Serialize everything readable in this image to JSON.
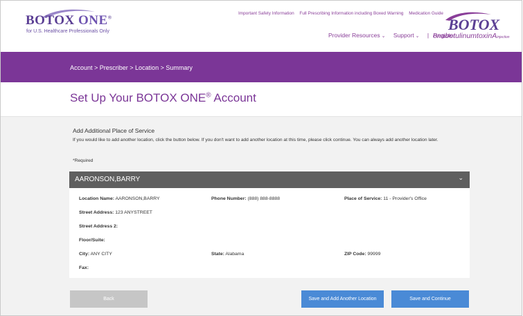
{
  "brand": {
    "left_logo": {
      "word": "BOTOX",
      "one": "ONE",
      "reg": "®",
      "tagline": "for U.S. Healthcare Professionals Only"
    },
    "right_logo": {
      "word": "BOTOX",
      "generic": "onabotulinumtoxinA",
      "generic_suffix": "injection"
    },
    "colors": {
      "purple": "#7b3697",
      "logo_purple": "#5b3f94",
      "button_blue": "#4a8ad6",
      "card_gray": "#5f5f5f"
    }
  },
  "header": {
    "top_links": [
      "Important Safety Information",
      "Full Prescribing Information including Boxed Warning",
      "Medication Guide"
    ],
    "nav": {
      "provider_resources": "Provider Resources",
      "support": "Support",
      "separator": "|",
      "register": "Register",
      "chevron_icon": "chevron-down-icon"
    }
  },
  "breadcrumb": "Account > Prescriber > Location > Summary",
  "page": {
    "title": "Set Up Your BOTOX ONE",
    "title_reg": "®",
    "title_suffix": " Account"
  },
  "intro": {
    "heading": "Add Additional Place of Service",
    "text": "If you would like to add another location, click the button below. If you don't want to add another location at this time, please click continue. You can always add another location later.",
    "required": "*Required"
  },
  "location_card": {
    "title": "AARONSON,BARRY",
    "chevron_icon": "chevron-down-icon",
    "location_name": {
      "label": "Location Name:",
      "value": "AARONSON,BARRY"
    },
    "phone": {
      "label": "Phone Number:",
      "value": "(888) 888-8888"
    },
    "place_of_service": {
      "label": "Place of Service:",
      "value": "11 - Provider's Office"
    },
    "street_1": {
      "label": "Street Address:",
      "value": "123 ANYSTREET"
    },
    "street_2": {
      "label": "Street Address 2:",
      "value": ""
    },
    "floor": {
      "label": "Floor/Suite:",
      "value": ""
    },
    "city": {
      "label": "City:",
      "value": "ANY CITY"
    },
    "state": {
      "label": "State:",
      "value": "Alabama"
    },
    "zip": {
      "label": "ZIP Code:",
      "value": "99999"
    },
    "fax": {
      "label": "Fax:",
      "value": ""
    }
  },
  "buttons": {
    "back": "Back",
    "add_location": "Save and Add Another Location",
    "continue": "Save and Continue"
  }
}
